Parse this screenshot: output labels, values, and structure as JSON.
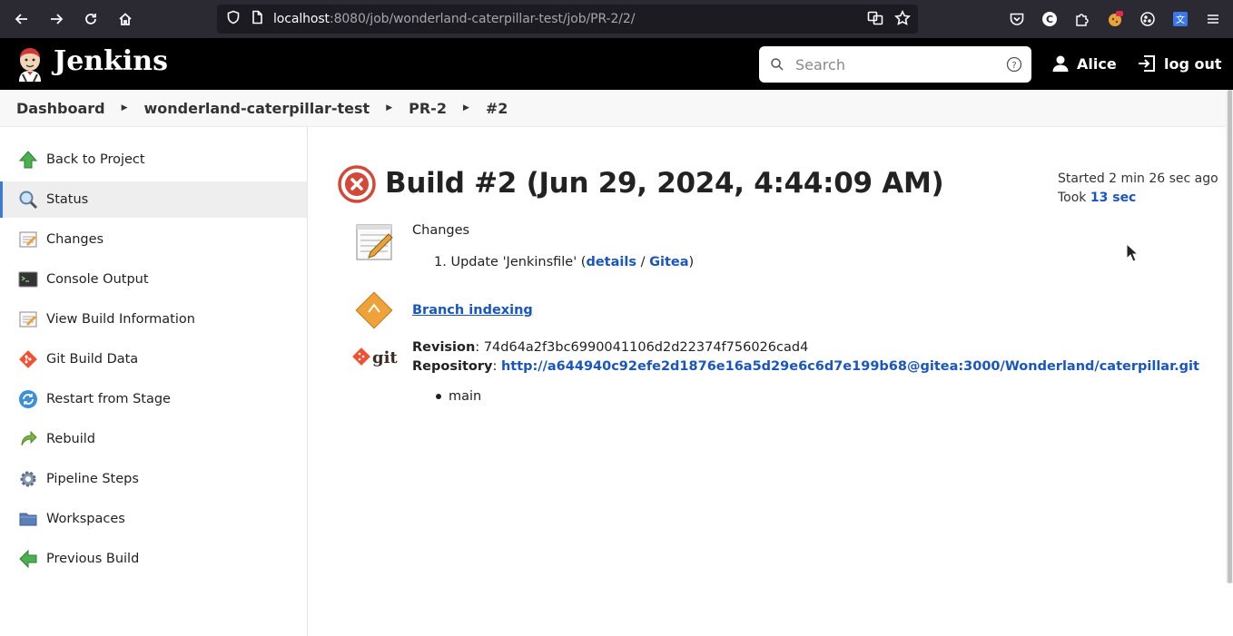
{
  "browser": {
    "url_host": "localhost",
    "url_rest": ":8080/job/wonderland-caterpillar-test/job/PR-2/2/"
  },
  "header": {
    "title": "Jenkins",
    "search_placeholder": "Search",
    "user_name": "Alice",
    "logout_label": "log out"
  },
  "breadcrumb": [
    "Dashboard",
    "wonderland-caterpillar-test",
    "PR-2",
    "#2"
  ],
  "sidebar": {
    "items": [
      {
        "label": "Back to Project",
        "icon": "up-arrow-icon"
      },
      {
        "label": "Status",
        "icon": "magnifier-icon"
      },
      {
        "label": "Changes",
        "icon": "notepad-icon"
      },
      {
        "label": "Console Output",
        "icon": "terminal-icon"
      },
      {
        "label": "View Build Information",
        "icon": "notepad-icon"
      },
      {
        "label": "Git Build Data",
        "icon": "git-icon"
      },
      {
        "label": "Restart from Stage",
        "icon": "restart-icon"
      },
      {
        "label": "Rebuild",
        "icon": "rebuild-icon"
      },
      {
        "label": "Pipeline Steps",
        "icon": "gear-icon"
      },
      {
        "label": "Workspaces",
        "icon": "folder-icon"
      },
      {
        "label": "Previous Build",
        "icon": "left-arrow-icon"
      }
    ]
  },
  "build": {
    "title": "Build #2 (Jun 29, 2024, 4:44:09 AM)",
    "status": "failed",
    "started": "Started 2 min 26 sec ago",
    "took_prefix": "Took ",
    "took_value": "13 sec"
  },
  "changes": {
    "title": "Changes",
    "item_number": "1.",
    "item_text": "Update 'Jenkinsfile' (",
    "details_label": "details",
    "separator": " / ",
    "gitea_label": "Gitea",
    "close": ")"
  },
  "branch_indexing_label": "Branch indexing",
  "git": {
    "revision_label": "Revision",
    "revision_value": "74d64a2f3bc6990041106d2d22374f756026cad4",
    "repository_label": "Repository",
    "repository_url": "http://a644940c92efe2d1876e16a5d29e6c6d7e199b68@gitea:3000/Wonderland/caterpillar.git",
    "branch": "main"
  },
  "colors": {
    "link": "#1a56c0",
    "failed": "#d24939",
    "header_bg": "#000000"
  }
}
